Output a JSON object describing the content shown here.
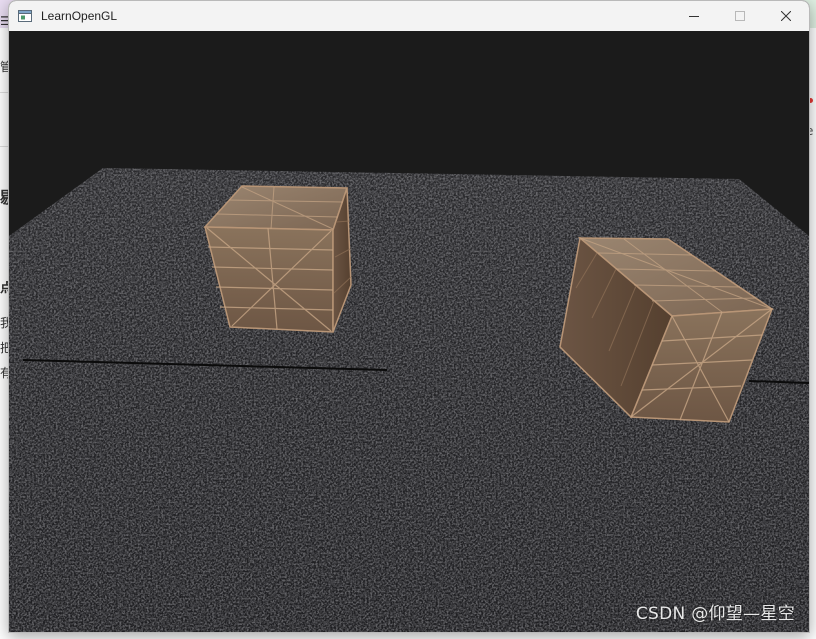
{
  "window": {
    "title": "LearnOpenGL",
    "controls": {
      "minimize": "minimize-icon",
      "maximize": "maximize-icon",
      "close": "close-icon"
    }
  },
  "background_page": {
    "left_fragments": [
      "管",
      "剔",
      "点",
      "我",
      "把",
      "有"
    ],
    "right_fragments": [
      "e"
    ]
  },
  "scene": {
    "clear_color": "#1b1b1b",
    "floor_texture": "asphalt",
    "objects": [
      "wooden-crate",
      "wooden-crate"
    ]
  },
  "watermark": "CSDN @仰望—星空"
}
